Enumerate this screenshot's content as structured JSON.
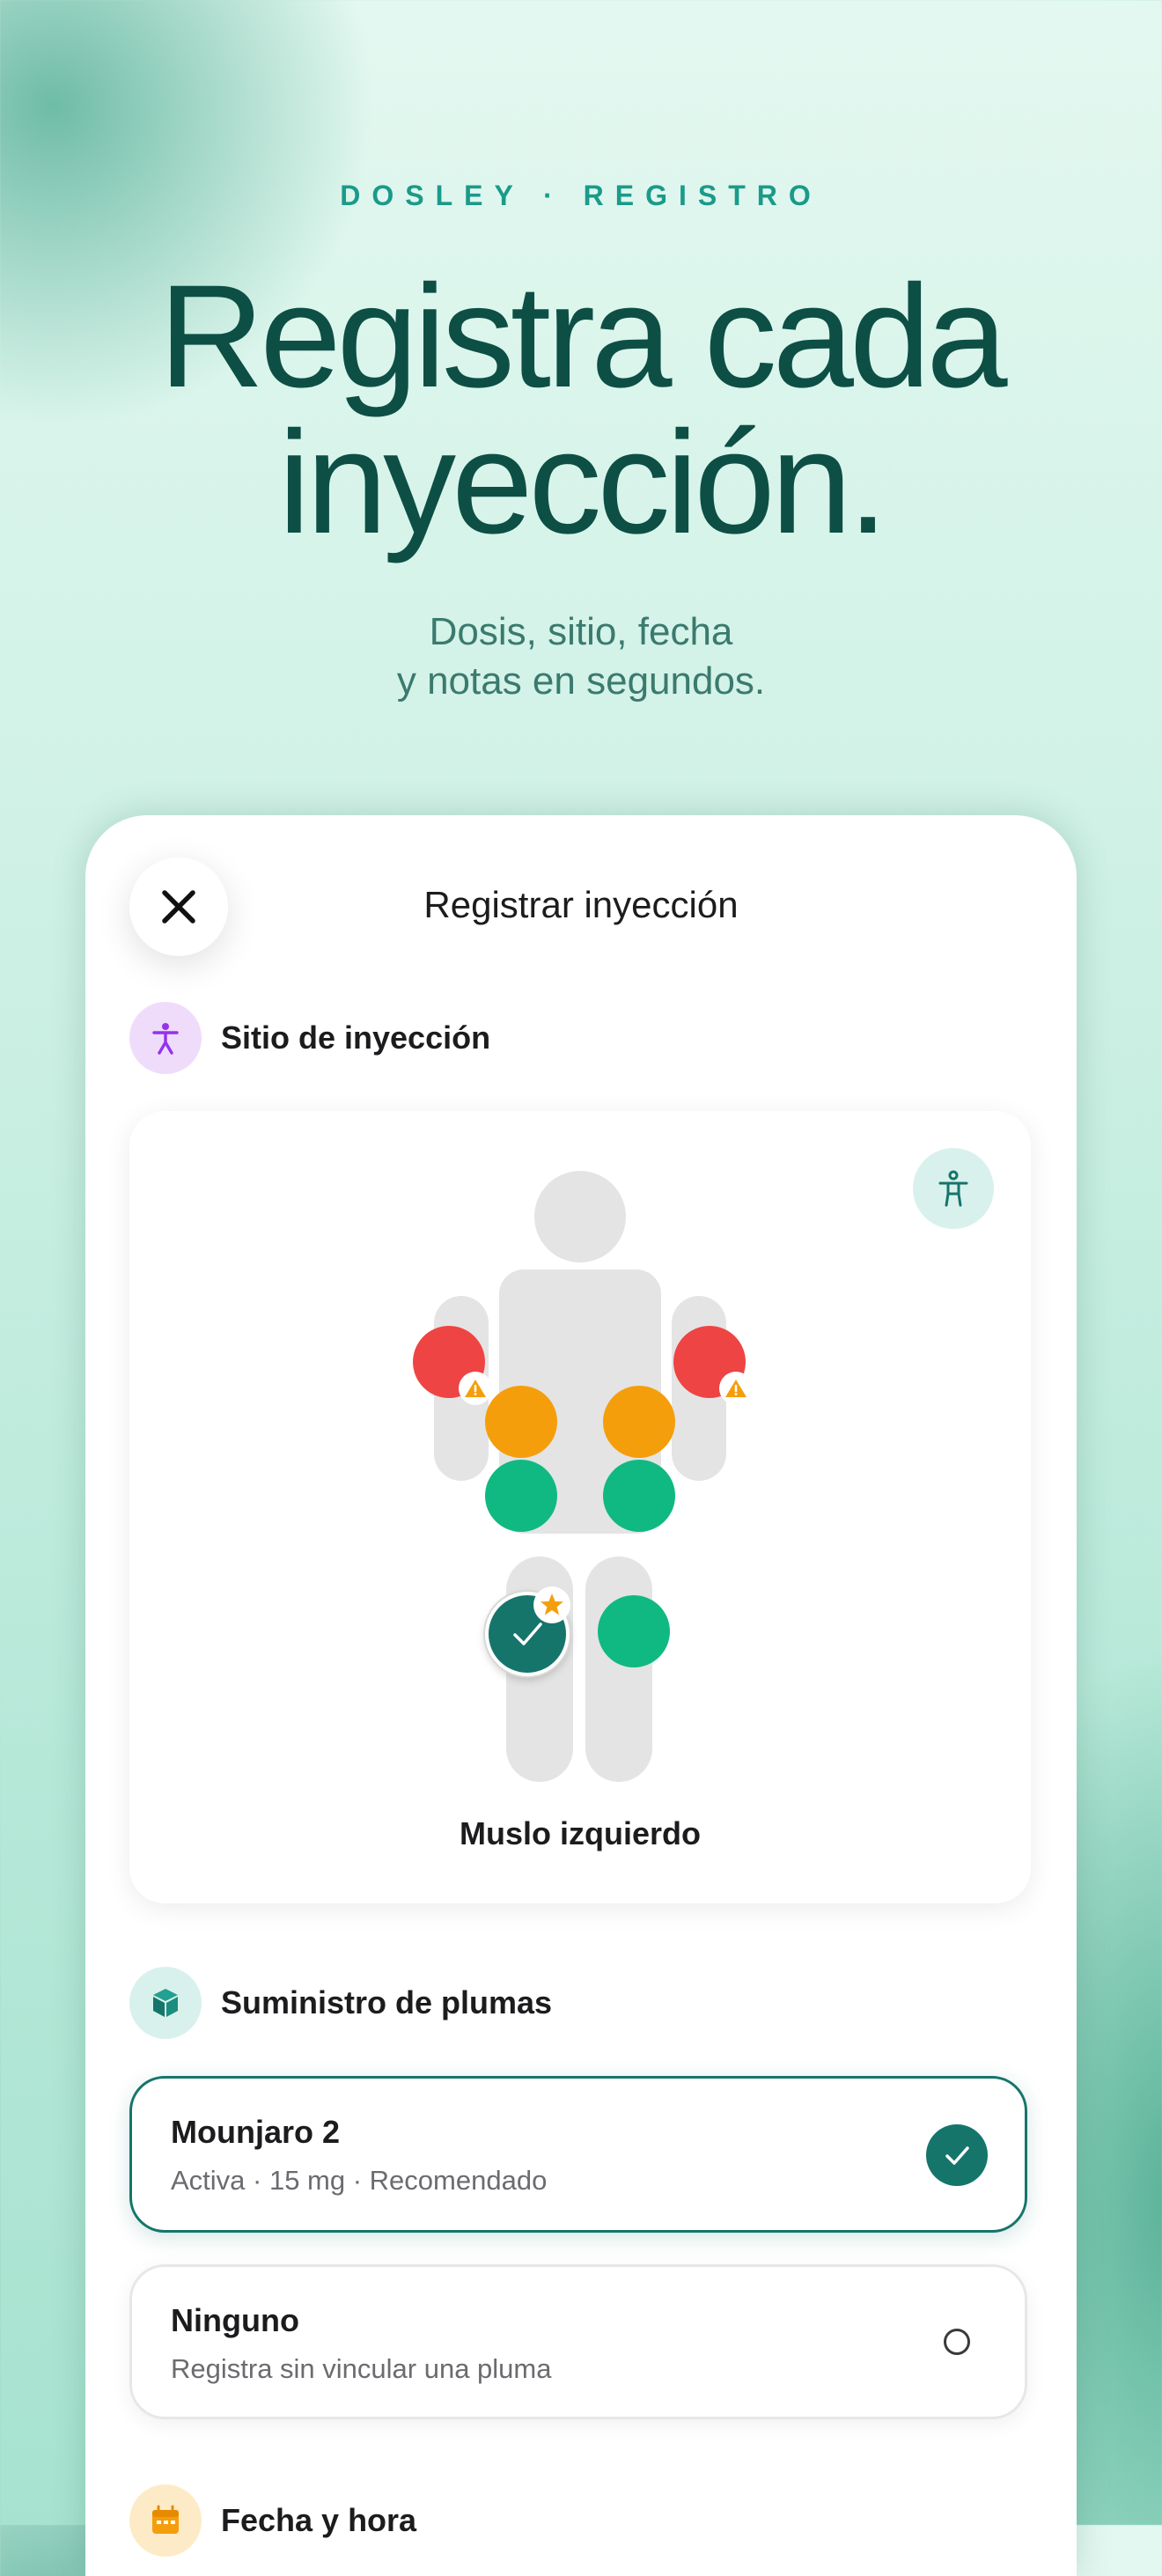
{
  "header": {
    "eyebrow": "DOSLEY · REGISTRO",
    "headline_line1": "Registra cada",
    "headline_line2": "inyección.",
    "subhead_line1": "Dosis, sitio, fecha",
    "subhead_line2": "y notas en segundos."
  },
  "screen": {
    "title": "Registrar inyección",
    "close_icon": "close-icon"
  },
  "injection_site": {
    "section_label": "Sitio de inyección",
    "section_icon": "person-figure-icon",
    "toggle_icon": "body-view-icon",
    "selected_site": "Muslo izquierdo",
    "colors": {
      "avoid": "#ef4444",
      "caution": "#f59e0b",
      "ok": "#10b981",
      "selected": "#15756b"
    }
  },
  "pen_supply": {
    "section_label": "Suministro de plumas",
    "section_icon": "box-icon",
    "options": [
      {
        "name": "Mounjaro 2",
        "detail": "Activa · 15 mg · Recomendado",
        "selected": true
      },
      {
        "name": "Ninguno",
        "detail": "Registra sin vincular una pluma",
        "selected": false
      }
    ]
  },
  "date_time": {
    "section_label": "Fecha y hora",
    "section_icon": "calendar-icon"
  }
}
